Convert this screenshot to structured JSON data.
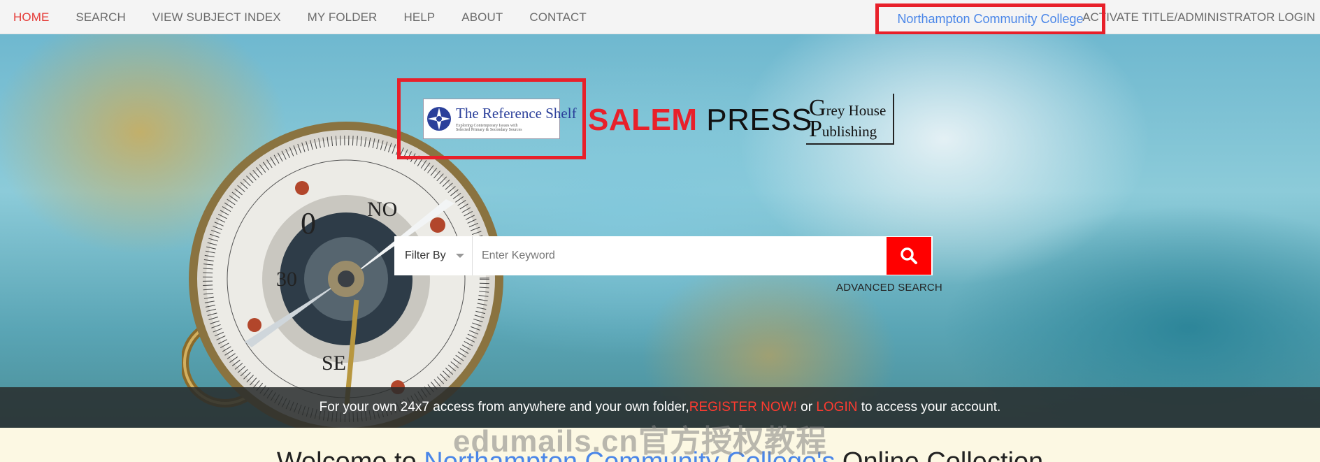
{
  "nav": {
    "items": [
      {
        "label": "HOME",
        "active": true
      },
      {
        "label": "SEARCH"
      },
      {
        "label": "VIEW SUBJECT INDEX"
      },
      {
        "label": "MY FOLDER"
      },
      {
        "label": "HELP"
      },
      {
        "label": "ABOUT"
      },
      {
        "label": "CONTACT"
      }
    ],
    "institution": "Northampton Community College",
    "right_link": "ACTIVATE TITLE/ADMINISTRATOR LOGIN"
  },
  "logos": {
    "reference_shelf": {
      "title": "The Reference Shelf",
      "sub1": "Exploring Contemporary Issues with",
      "sub2": "Selected Primary & Secondary Sources"
    },
    "salem_red": "SALEM",
    "salem_black": "PRESS",
    "greyhouse": {
      "g": "G",
      "line1": "rey House",
      "p": "P",
      "line2": "ublishing"
    }
  },
  "search": {
    "filter_label": "Filter By",
    "placeholder": "Enter Keyword",
    "advanced_label": "ADVANCED SEARCH",
    "button_icon": "search-icon"
  },
  "banner": {
    "text1": "For your own 24x7 access from anywhere and your own folder, ",
    "register": "REGISTER NOW!",
    "text2": " or ",
    "login": "LOGIN",
    "text3": " to access your account."
  },
  "welcome": {
    "prefix": "Welcome to ",
    "institution": "Northampton Community College's",
    "suffix": " Online Collection"
  },
  "watermark": "edumails.cn官方授权教程",
  "colors": {
    "accent_red": "#e8202a",
    "link_blue": "#4a86e8",
    "search_button": "#ff0000",
    "banner_bg": "#2c2e2e",
    "welcome_bg": "#fcf8e3"
  }
}
